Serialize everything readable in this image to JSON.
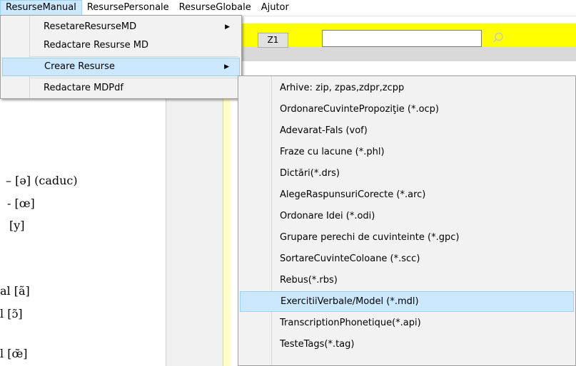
{
  "menubar": {
    "items": [
      "ResurseManual",
      "ResursePersonale",
      "ResurseGlobale",
      "Ajutor"
    ]
  },
  "toolbar": {
    "z1_label": "Z1",
    "search_value": "",
    "accent_color": "#ffff00"
  },
  "left_panel": {
    "lines": [
      "– [ə] (caduc)",
      "- [œ]",
      "[y]",
      "al [ã]",
      "l [ɔ̃]",
      "l [œ̃]"
    ]
  },
  "resurse_menu": {
    "items": [
      {
        "label": "ResetareResurseMD",
        "has_submenu": true
      },
      {
        "label": "Redactare Resurse MD",
        "has_submenu": false
      },
      {
        "label": "Creare Resurse",
        "has_submenu": true,
        "highlighted": true
      },
      {
        "label": "Redactare MDPdf",
        "has_submenu": false
      }
    ]
  },
  "creare_submenu": {
    "items": [
      "Arhive: zip, zpas,zdpr,zcpp",
      "OrdonareCuvintePropoziţie (*.ocp)",
      "Adevarat-Fals (vof)",
      "Fraze cu lacune (*.phl)",
      "Dictări(*.drs)",
      "AlegeRaspunsuriCorecte (*.arc)",
      "Ordonare Idei (*.odi)",
      "Grupare perechi de cuvinteinte  (*.gpc)",
      "SortareCuvinteColoane (*.scc)",
      "Rebus(*.rbs)",
      "ExercitiiVerbale/Model (*.mdl)",
      "TranscriptionPhonetique(*.api)",
      "TesteTags(*.tag)"
    ],
    "highlighted_index": 10
  }
}
